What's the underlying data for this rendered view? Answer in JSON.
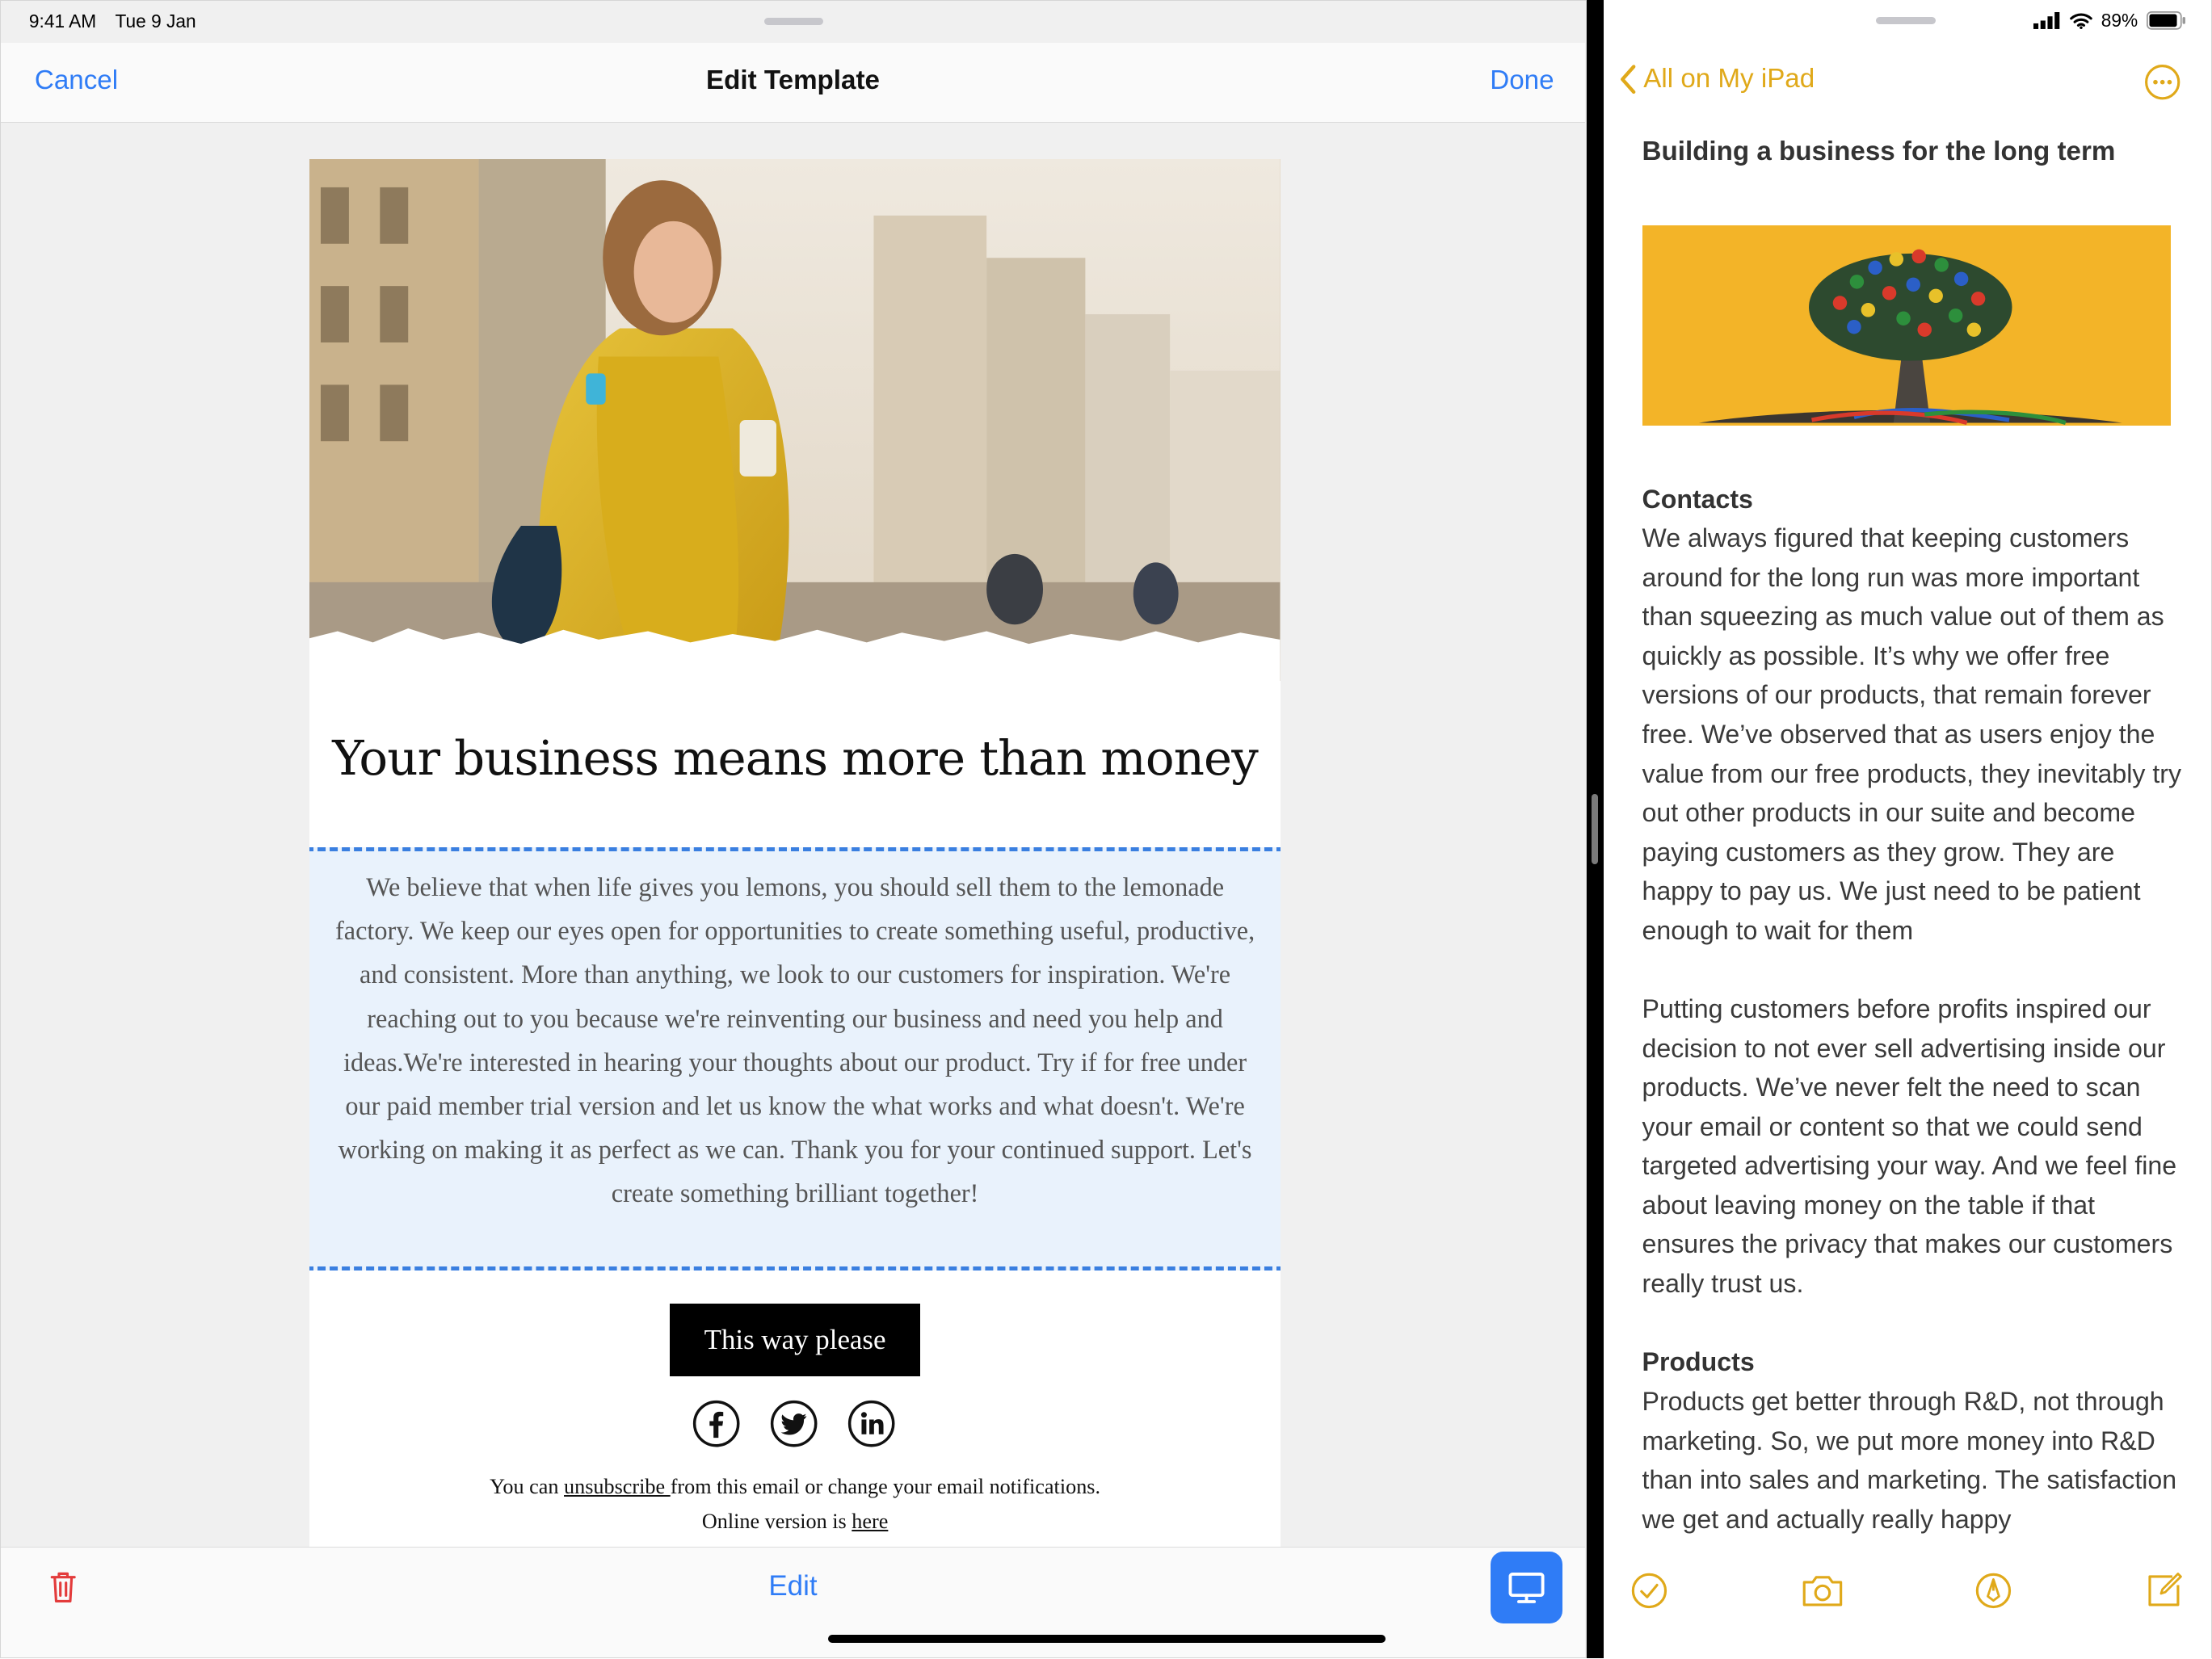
{
  "status_bar": {
    "time": "9:41 AM",
    "date": "Tue 9 Jan",
    "battery": "89%"
  },
  "template_editor": {
    "cancel_label": "Cancel",
    "title": "Edit Template",
    "done_label": "Done",
    "email": {
      "heading": "Your business means more than money",
      "body": "We believe that when life gives you lemons, you should sell them to the lemonade factory. We keep our eyes open for opportunities to create something useful, productive, and consistent. More than anything, we look to our customers for inspiration. We're reaching out to you because we're reinventing our business and need you help and ideas.We're interested in hearing your thoughts about our product. Try if for free under our paid member trial version and let us know the what works and what doesn't. We're working on making it as perfect as we can. Thank you for your continued support. Let's create something brilliant together!",
      "cta_label": "This way please",
      "social_icons": [
        "facebook-icon",
        "twitter-icon",
        "linkedin-icon"
      ],
      "footer": {
        "prefix": "You can ",
        "unsubscribe_link": "unsubscribe ",
        "suffix": "from this email or change your email notifications.",
        "online_prefix": "Online version is ",
        "online_link": "here"
      }
    },
    "bottom_bar": {
      "edit_label": "Edit"
    }
  },
  "notes": {
    "back_label": "All on My iPad",
    "title": "Building a business for the long term",
    "sections": {
      "contacts_heading": "Contacts",
      "contacts_text": "We always figured that keeping customers around for the long run was more important than squeezing as much value out of them as quickly as possible. It’s why we offer free versions of our products, that remain forever free. We’ve observed that as users enjoy the value from our free products, they inevitably try out other products in our suite and become paying customers as they grow. They are happy to pay us. We just need to be patient enough to wait for them",
      "advertising_text": "Putting customers before profits inspired our decision to not ever sell advertising inside our products. We’ve never felt the need to scan your email or content so that we could send targeted advertising your way. And we feel fine about leaving money on the table if that ensures the privacy that makes our customers really trust us.",
      "products_heading": "Products",
      "products_text": "Products get better through R&D, not through marketing. So, we put more money into R&D than into sales and marketing. The satisfaction we get and actually really happy"
    },
    "toolbar": [
      "checklist-icon",
      "camera-icon",
      "markup-icon",
      "compose-icon"
    ],
    "accent_color": "#e0a91a"
  },
  "colors": {
    "link_blue": "#2f7cf6",
    "selection_border": "#3a7fe0",
    "selection_fill": "#e9f2fc"
  }
}
